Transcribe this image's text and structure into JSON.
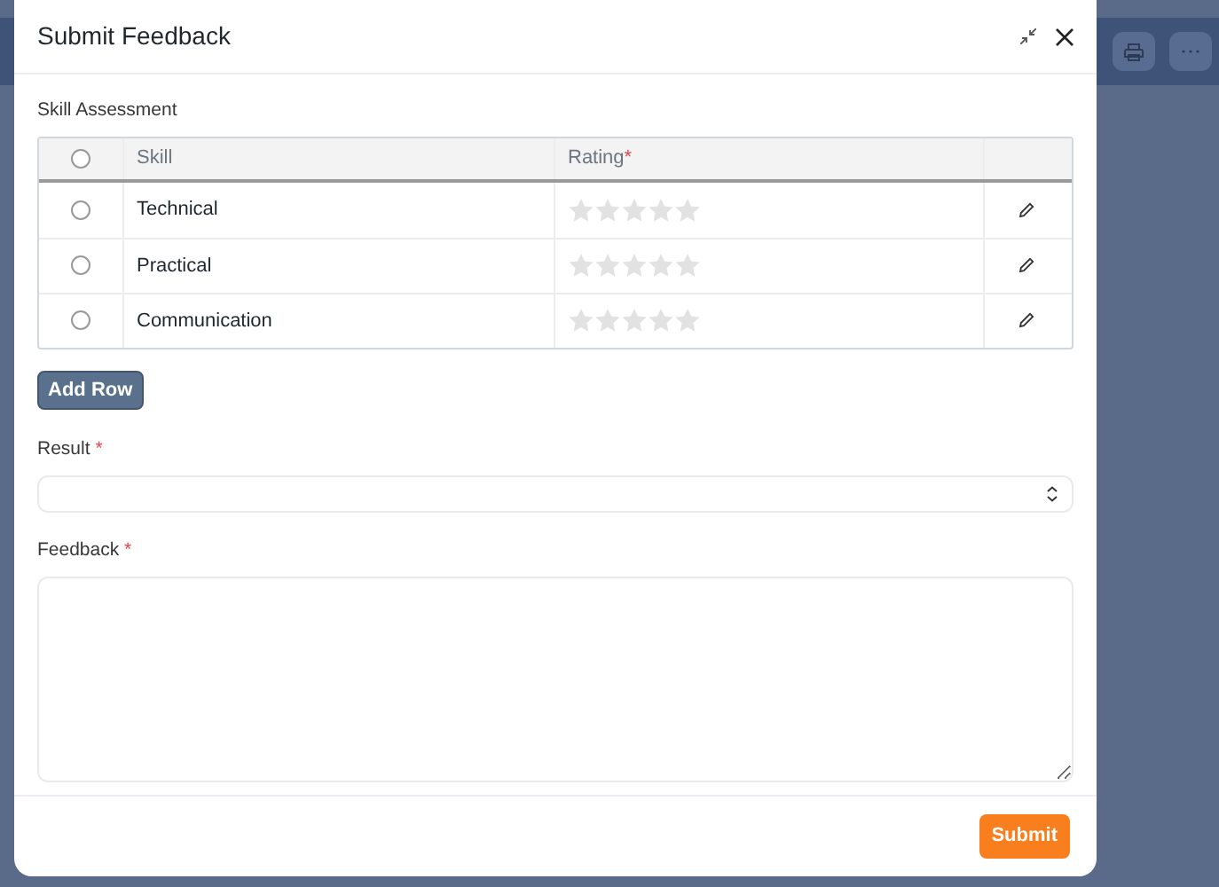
{
  "dialog": {
    "title": "Submit Feedback"
  },
  "skill_assessment": {
    "label": "Skill Assessment",
    "columns": [
      {
        "label": "Skill"
      },
      {
        "label": "Rating",
        "required_mark": "*"
      }
    ],
    "header_selected": false,
    "rows": [
      {
        "selected": false,
        "skill": "Technical",
        "stars": 0
      },
      {
        "selected": false,
        "skill": "Practical",
        "stars": 0
      },
      {
        "selected": false,
        "skill": "Communication",
        "stars": 0
      }
    ],
    "add_button": "Add Row"
  },
  "result": {
    "label": "Result",
    "required_mark": "*"
  },
  "feedback": {
    "label": "Feedback",
    "required_mark": "*"
  },
  "submit_button": "Submit"
}
